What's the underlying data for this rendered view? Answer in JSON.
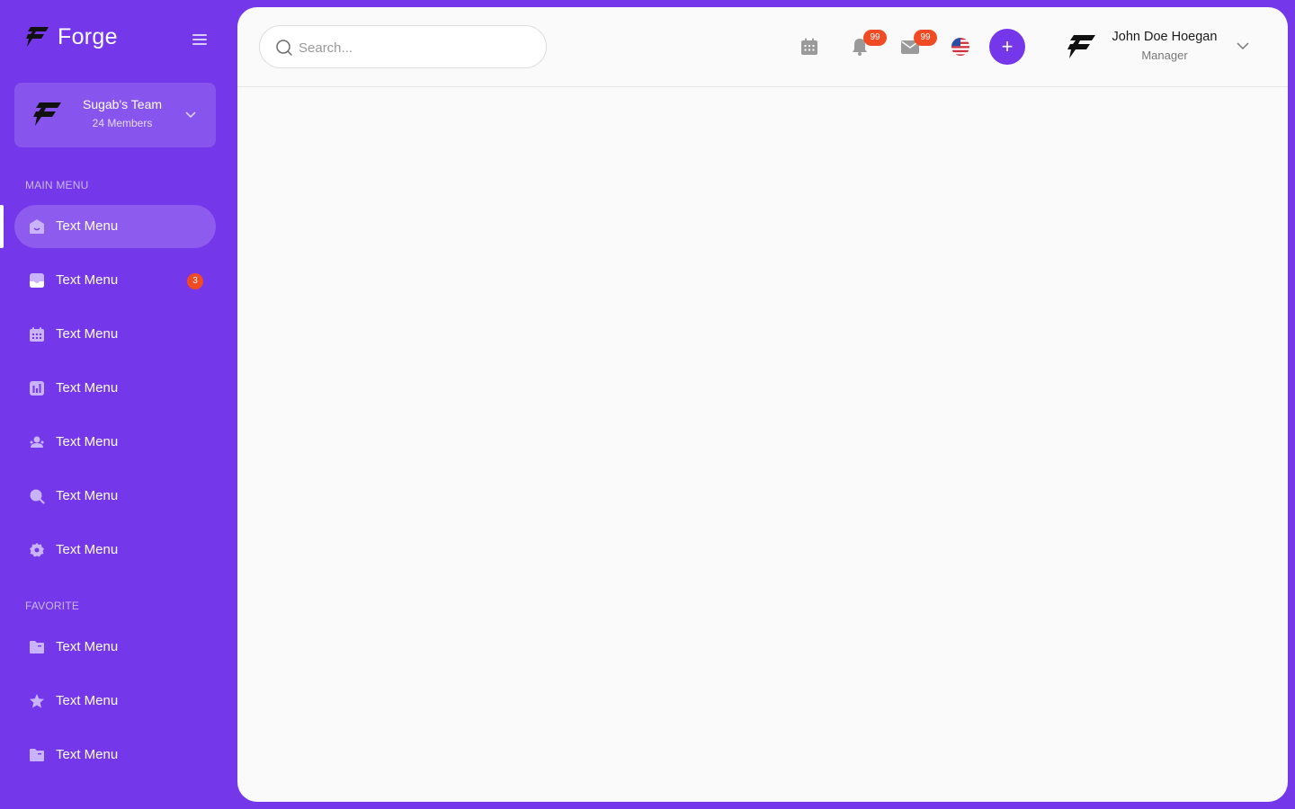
{
  "brand": {
    "name": "Forge"
  },
  "team": {
    "name": "Sugab's Team",
    "members": "24 Members"
  },
  "sidebar": {
    "main_menu_label": "MAIN MENU",
    "favorite_label": "FAVORITE",
    "main_items": [
      {
        "label": "Text Menu",
        "icon": "home-icon",
        "active": true
      },
      {
        "label": "Text Menu",
        "icon": "inbox-icon",
        "badge": "3"
      },
      {
        "label": "Text Menu",
        "icon": "calendar-icon"
      },
      {
        "label": "Text Menu",
        "icon": "chart-icon"
      },
      {
        "label": "Text Menu",
        "icon": "users-icon"
      },
      {
        "label": "Text Menu",
        "icon": "search-icon"
      },
      {
        "label": "Text Menu",
        "icon": "settings-icon"
      }
    ],
    "favorite_items": [
      {
        "label": "Text Menu",
        "icon": "folder-icon"
      },
      {
        "label": "Text Menu",
        "icon": "star-icon"
      },
      {
        "label": "Text Menu",
        "icon": "folder-icon"
      }
    ]
  },
  "search": {
    "placeholder": "Search..."
  },
  "topbar": {
    "notifications_badge": "99",
    "messages_badge": "99",
    "add_label": "+"
  },
  "user": {
    "name": "John Doe Hoegan",
    "role": "Manager"
  },
  "colors": {
    "sidebar_bg": "#7438EA",
    "badge": "#F04B23",
    "content_bg": "#FAFAFA"
  }
}
